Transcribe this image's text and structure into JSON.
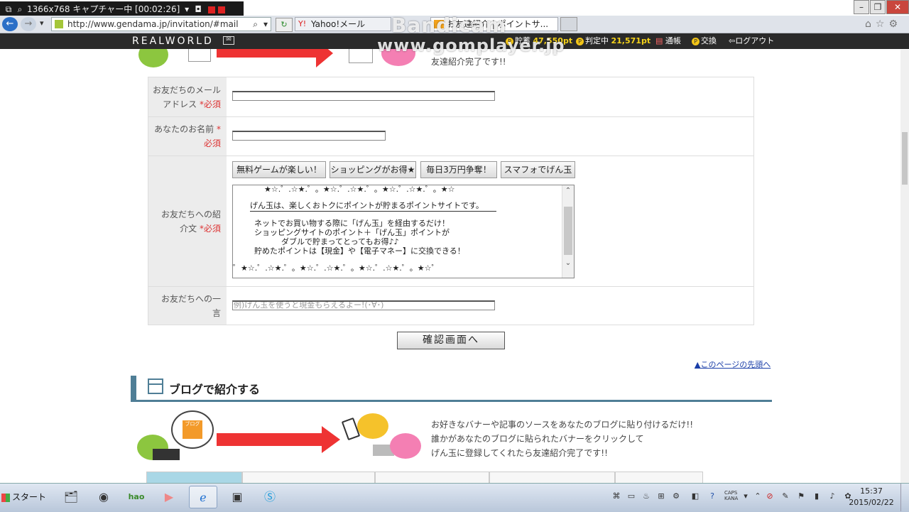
{
  "capture_bar": {
    "text": "1366x768 キャプチャー中 [00:02:26]"
  },
  "browser": {
    "url": "http://www.gendama.jp/invitation/#mail",
    "tabs": [
      {
        "label": "Yahoo!メール"
      },
      {
        "label": "お友達紹介 | ポイントサ..."
      }
    ]
  },
  "watermark": {
    "line1": "Bandicam",
    "line2": "www.gomplayer.jp"
  },
  "site_header": {
    "logo": "REALWORLD",
    "points_label": "貯蓄",
    "points_value": "47,550pt",
    "pending_label": "判定中",
    "pending_value": "21,571pt",
    "nav_notice": "通帳",
    "nav_exchange": "交換",
    "nav_logout": "ログアウト"
  },
  "intro": {
    "text": "友達紹介完了です!!"
  },
  "form": {
    "required_mark": "*必須",
    "friend_email_label_1": "お友だちのメール",
    "friend_email_label_2": "アドレス",
    "your_name_label_1": "あなたのお名前",
    "your_name_label_2": "必須",
    "message_label_1": "お友だちへの紹",
    "message_label_2": "介文",
    "comment_label_1": "お友だちへの一",
    "comment_label_2": "言",
    "comment_placeholder": "例)げん玉を使うと現金もらえるよー!(･∀･)",
    "templates": [
      "無料ゲームが楽しい！",
      "ショッピングがお得★",
      "毎日3万円争奪！",
      "スマフォでげん玉"
    ],
    "message_lines": [
      "★☆.゜.☆★.゜。★☆.゜.☆★.゜。★☆.゜.☆★.゜。★☆",
      "げん玉は、楽しくおトクにポイントが貯まるポイントサイトです。",
      "ネットでお買い物する際に「げん玉」を経由するだけ！",
      "ショッピングサイトのポイント＋「げん玉」ポイントが",
      "ダブルで貯まってとってもお得♪♪",
      "貯めたポイントは【現金】や【電子マネー】に交換できる！",
      "゜★☆.゜.☆★.゜。★☆.゜.☆★.゜。★☆.゜.☆★.゜。★☆゜"
    ],
    "confirm_label": "確認画面へ"
  },
  "page_top_link": "▲このページの先頭へ",
  "blog": {
    "title": "ブログで紹介する",
    "bubble_text": "ブログ",
    "text_lines": [
      "お好きなバナーや記事のソースをあなたのブログに貼り付けるだけ!!",
      "誰かがあなたのブログに貼られたバナーをクリックして",
      "げん玉に登録してくれたら友達紹介完了です!!"
    ]
  },
  "taskbar": {
    "start_label": "スタート",
    "time": "15:37",
    "date": "2015/02/22"
  }
}
